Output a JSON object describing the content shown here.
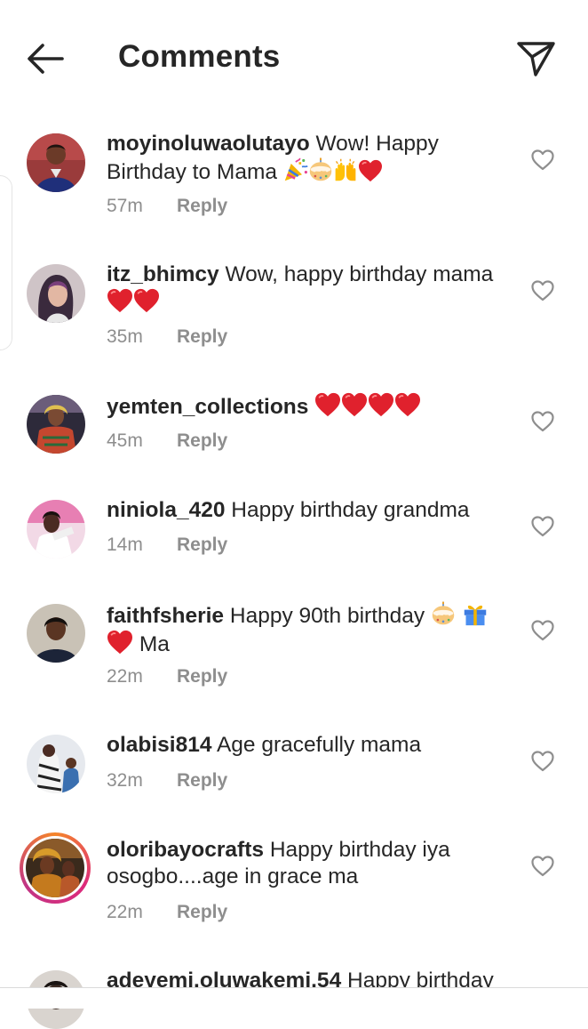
{
  "header": {
    "title": "Comments"
  },
  "icons": {
    "back": "arrow-left-icon",
    "share": "paper-plane-icon",
    "like": "heart-outline-icon",
    "heart_emoji": "red-heart",
    "party_emoji": "party-popper",
    "cake_emoji": "birthday-cake",
    "hands_emoji": "raising-hands",
    "gift_emoji": "wrapped-gift"
  },
  "colors": {
    "text": "#262626",
    "muted": "#8e8e8e",
    "heart": "#e0212d",
    "story_ring": "#dd2a7b"
  },
  "reply_label": "Reply",
  "comments": [
    {
      "username": "moyinoluwaolutayo",
      "text": "Wow! Happy Birthday to Mama",
      "time": "57m"
    },
    {
      "username": "itz_bhimcy",
      "text": "Wow, happy birthday mama",
      "time": "35m"
    },
    {
      "username": "yemten_collections",
      "text": "",
      "time": "45m"
    },
    {
      "username": "niniola_420",
      "text": "Happy birthday grandma",
      "time": "14m"
    },
    {
      "username": "faithfsherie",
      "text": "Happy 90th birthday",
      "text2": "Ma",
      "time": "22m"
    },
    {
      "username": "olabisi814",
      "text": "Age gracefully mama",
      "time": "32m"
    },
    {
      "username": "oloribayocrafts",
      "text": "Happy birthday iya osogbo....age in grace ma",
      "time": "22m"
    },
    {
      "username": "adeyemi.oluwakemi.54",
      "text": "Happy birthday"
    }
  ]
}
